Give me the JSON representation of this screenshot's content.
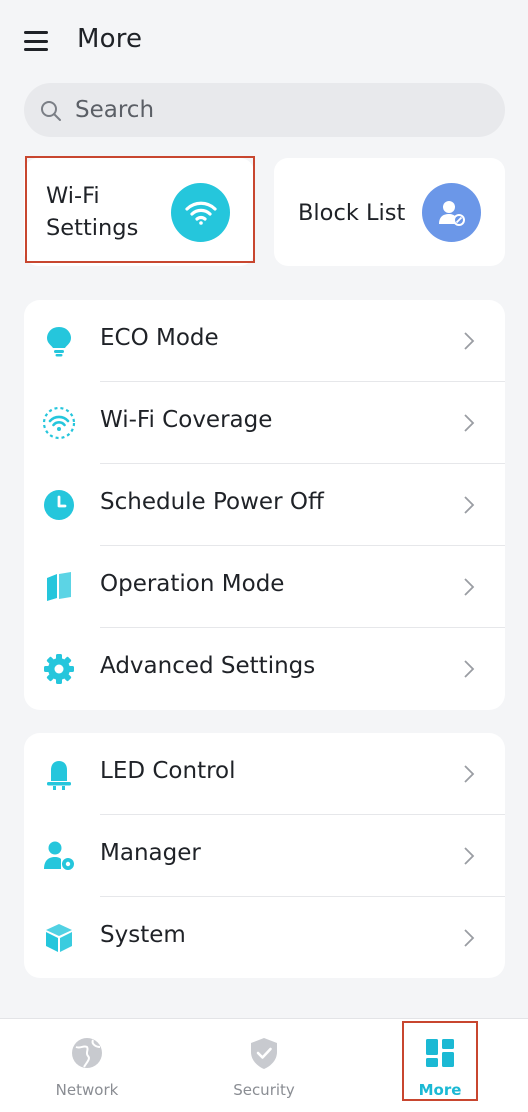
{
  "header": {
    "title": "More",
    "menu_icon": "hamburger-menu-icon"
  },
  "search": {
    "placeholder": "Search",
    "icon": "search-icon"
  },
  "quick_actions": [
    {
      "label_line1": "Wi-Fi",
      "label_line2": "Settings",
      "icon": "wifi-icon",
      "color": "#25c6dc",
      "highlighted": true
    },
    {
      "label": "Block List",
      "icon": "user-block-icon",
      "color": "#6b97e8"
    }
  ],
  "menu_group_1": [
    {
      "label": "ECO Mode",
      "icon": "lightbulb-icon"
    },
    {
      "label": "Wi-Fi Coverage",
      "icon": "wifi-coverage-icon"
    },
    {
      "label": "Schedule Power Off",
      "icon": "clock-icon"
    },
    {
      "label": "Operation Mode",
      "icon": "book-icon"
    },
    {
      "label": "Advanced Settings",
      "icon": "gear-icon"
    }
  ],
  "menu_group_2": [
    {
      "label": "LED Control",
      "icon": "led-icon"
    },
    {
      "label": "Manager",
      "icon": "user-settings-icon"
    },
    {
      "label": "System",
      "icon": "cube-icon"
    }
  ],
  "tabbar": [
    {
      "label": "Network",
      "icon": "globe-icon",
      "active": false
    },
    {
      "label": "Security",
      "icon": "shield-icon",
      "active": false
    },
    {
      "label": "More",
      "icon": "grid-icon",
      "active": true,
      "highlighted": true
    }
  ],
  "colors": {
    "accent": "#25c6dc",
    "block_list": "#6b97e8",
    "highlight": "#c8462f",
    "active_tab": "#1bb9d4"
  }
}
